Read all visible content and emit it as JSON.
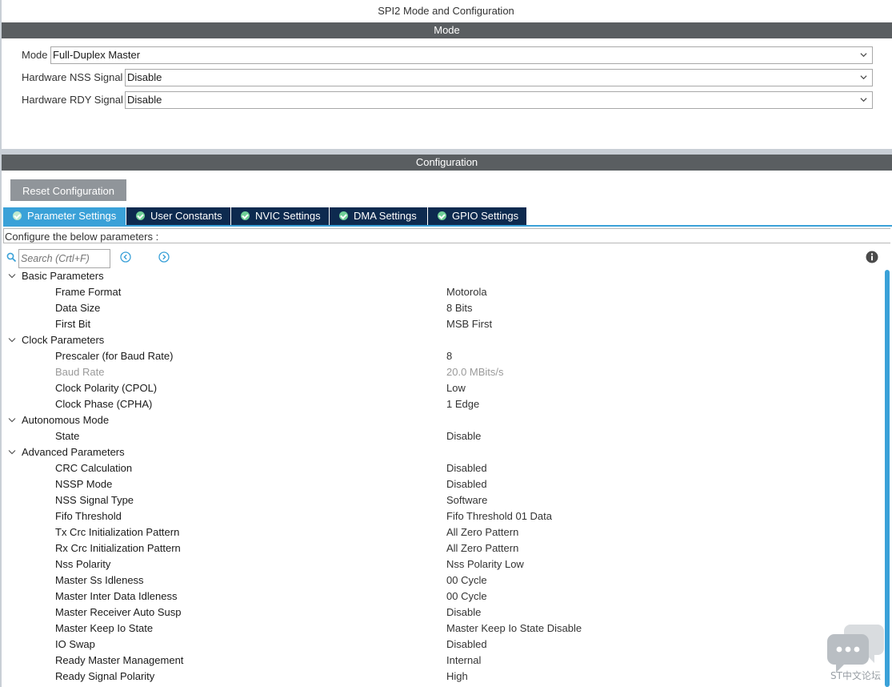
{
  "window": {
    "title": "SPI2 Mode and Configuration"
  },
  "mode_section": {
    "header": "Mode",
    "fields": [
      {
        "label": "Mode",
        "value": "Full-Duplex Master"
      },
      {
        "label": "Hardware NSS Signal",
        "value": "Disable"
      },
      {
        "label": "Hardware RDY Signal",
        "value": "Disable"
      }
    ]
  },
  "config_section": {
    "header": "Configuration",
    "reset_label": "Reset Configuration",
    "tabs": [
      {
        "label": "Parameter Settings",
        "active": true
      },
      {
        "label": "User Constants",
        "active": false
      },
      {
        "label": "NVIC Settings",
        "active": false
      },
      {
        "label": "DMA Settings",
        "active": false
      },
      {
        "label": "GPIO Settings",
        "active": false
      }
    ],
    "description": "Configure the below parameters :",
    "search": {
      "placeholder": "Search (Crtl+F)"
    }
  },
  "groups": [
    {
      "label": "Basic Parameters",
      "params": [
        {
          "label": "Frame Format",
          "value": "Motorola"
        },
        {
          "label": "Data Size",
          "value": "8 Bits"
        },
        {
          "label": "First Bit",
          "value": "MSB First"
        }
      ]
    },
    {
      "label": "Clock Parameters",
      "params": [
        {
          "label": "Prescaler (for Baud Rate)",
          "value": "8"
        },
        {
          "label": "Baud Rate",
          "value": "20.0 MBits/s",
          "disabled": true
        },
        {
          "label": "Clock Polarity (CPOL)",
          "value": "Low"
        },
        {
          "label": "Clock Phase (CPHA)",
          "value": "1 Edge"
        }
      ]
    },
    {
      "label": "Autonomous Mode",
      "params": [
        {
          "label": "State",
          "value": "Disable"
        }
      ]
    },
    {
      "label": "Advanced Parameters",
      "params": [
        {
          "label": "CRC Calculation",
          "value": "Disabled"
        },
        {
          "label": "NSSP Mode",
          "value": "Disabled"
        },
        {
          "label": "NSS Signal Type",
          "value": "Software"
        },
        {
          "label": "Fifo Threshold",
          "value": "Fifo Threshold 01 Data"
        },
        {
          "label": "Tx Crc Initialization Pattern",
          "value": "All Zero Pattern"
        },
        {
          "label": "Rx Crc Initialization Pattern",
          "value": "All Zero Pattern"
        },
        {
          "label": "Nss Polarity",
          "value": "Nss Polarity Low"
        },
        {
          "label": "Master Ss Idleness",
          "value": "00 Cycle"
        },
        {
          "label": "Master Inter Data Idleness",
          "value": "00 Cycle"
        },
        {
          "label": "Master Receiver Auto Susp",
          "value": "Disable"
        },
        {
          "label": "Master Keep Io State",
          "value": "Master Keep Io State Disable"
        },
        {
          "label": "IO Swap",
          "value": "Disabled"
        },
        {
          "label": "Ready Master Management",
          "value": "Internal"
        },
        {
          "label": "Ready Signal Polarity",
          "value": "High"
        }
      ]
    }
  ],
  "watermark": {
    "text": "ST中文论坛",
    "icon": "chat-bubbles-icon"
  },
  "colors": {
    "header_bar": "#5a5e61",
    "active_tab": "#3aa1d8",
    "inactive_tab": "#0d2a4f",
    "reset_button": "#90959a",
    "check_badge": "#6fcf97"
  }
}
